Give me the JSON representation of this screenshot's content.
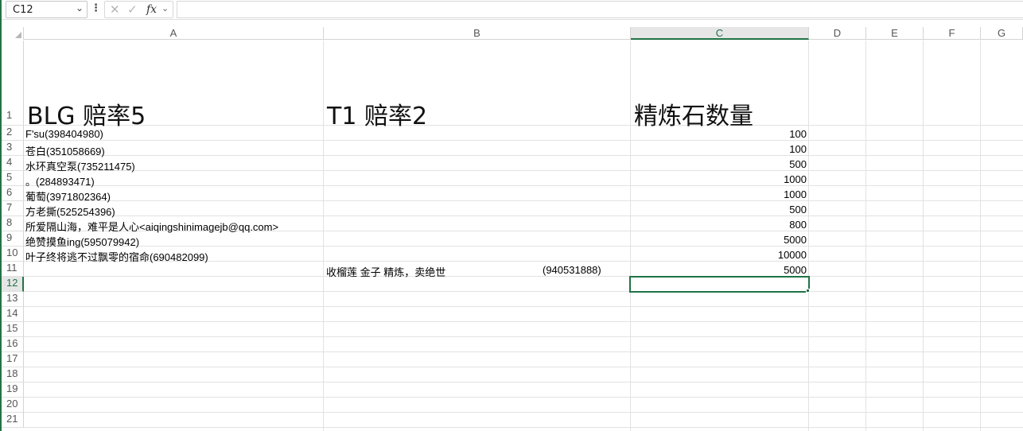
{
  "formula_bar": {
    "name_box": "C12",
    "name_box_caret": "⌄",
    "menu_dots": "⋮",
    "cancel_glyph": "✕",
    "enter_glyph": "✓",
    "fx_label": "fx",
    "fx_caret": "⌄",
    "formula": ""
  },
  "sheet": {
    "active_cell": "C12",
    "accent_color": "#217346",
    "columns": [
      "A",
      "B",
      "C",
      "D",
      "E",
      "F",
      "G"
    ],
    "rows": [
      "1",
      "2",
      "3",
      "4",
      "5",
      "6",
      "7",
      "8",
      "9",
      "10",
      "11",
      "12",
      "13",
      "14",
      "15",
      "16",
      "17",
      "18",
      "19",
      "20",
      "21"
    ],
    "header_row": {
      "A1": "BLG 赔率5",
      "B1": "T1 赔率2",
      "C1": "精炼石数量"
    },
    "entries": [
      {
        "name": "F'su(398404980)",
        "qty": "100"
      },
      {
        "name": "苍白(351058669)",
        "qty": "100"
      },
      {
        "name": "水环真空泵(735211475)",
        "qty": "500"
      },
      {
        "name": "。(284893471)",
        "qty": "1000"
      },
      {
        "name": "葡萄(3971802364)",
        "qty": "1000"
      },
      {
        "name": "方老撕(525254396)",
        "qty": "500"
      },
      {
        "name": "所爱隔山海，难平是人心<aiqingshinimagejb@qq.com>",
        "qty": "800"
      },
      {
        "name": "绝赞摸鱼ing(595079942)",
        "qty": "5000"
      },
      {
        "name": "叶子终将逃不过飘零的宿命(690482099)",
        "qty": "10000"
      }
    ],
    "row11": {
      "B11": "收榴莲 金子 精炼，卖绝世",
      "B11_extra": "(940531888)",
      "C11": "5000"
    }
  }
}
